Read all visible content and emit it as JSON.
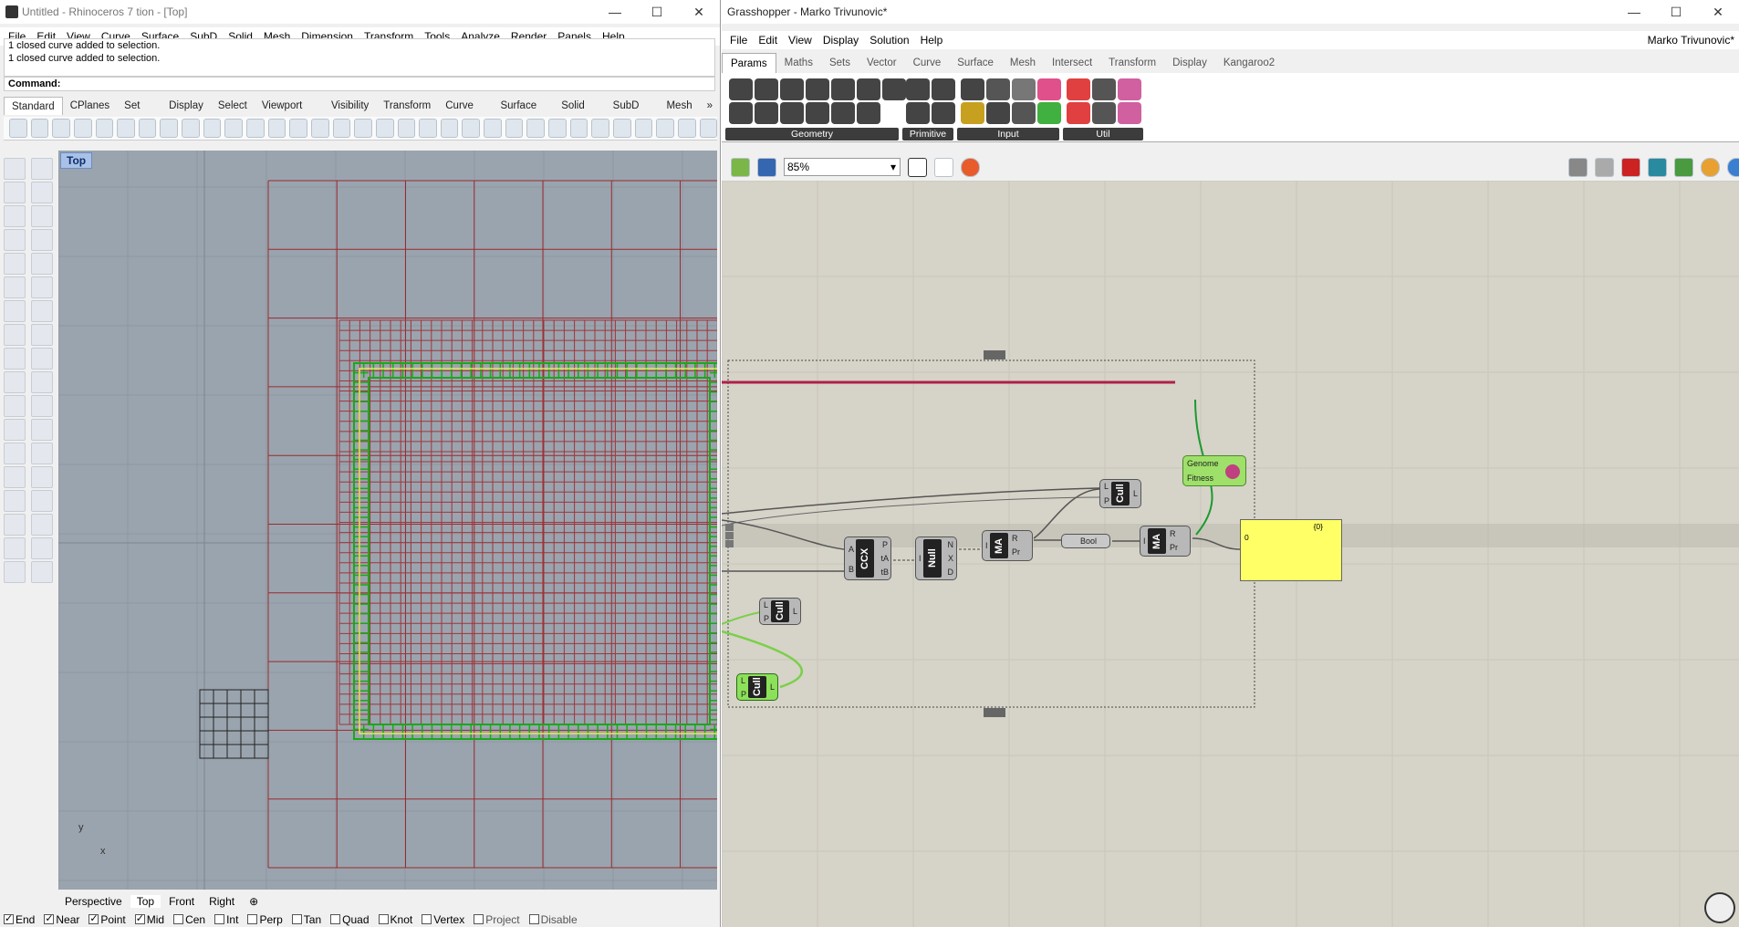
{
  "rhino": {
    "title": "Untitled - Rhinoceros 7 tion - [Top]",
    "menu": [
      "File",
      "Edit",
      "View",
      "Curve",
      "Surface",
      "SubD",
      "Solid",
      "Mesh",
      "Dimension",
      "Transform",
      "Tools",
      "Analyze",
      "Render",
      "Panels",
      "Help"
    ],
    "history": [
      "1 closed curve added to selection.",
      "1 closed curve added to selection."
    ],
    "command_label": "Command:",
    "tabs": [
      "Standard",
      "CPlanes",
      "Set View",
      "Display",
      "Select",
      "Viewport Layout",
      "Visibility",
      "Transform",
      "Curve Tools",
      "Surface Tools",
      "Solid Tools",
      "SubD Tools",
      "Mesh",
      "»"
    ],
    "viewport_label": "Top",
    "axis_y": "y",
    "axis_x": "x",
    "view_tabs": [
      "Perspective",
      "Top",
      "Front",
      "Right"
    ],
    "osnaps": [
      {
        "label": "End",
        "on": true
      },
      {
        "label": "Near",
        "on": true
      },
      {
        "label": "Point",
        "on": true
      },
      {
        "label": "Mid",
        "on": true
      },
      {
        "label": "Cen",
        "on": false
      },
      {
        "label": "Int",
        "on": false
      },
      {
        "label": "Perp",
        "on": false
      },
      {
        "label": "Tan",
        "on": false
      },
      {
        "label": "Quad",
        "on": false
      },
      {
        "label": "Knot",
        "on": false
      },
      {
        "label": "Vertex",
        "on": false
      },
      {
        "label": "Project",
        "on": false
      },
      {
        "label": "Disable",
        "on": false
      }
    ]
  },
  "grasshopper": {
    "title": "Grasshopper - Marko Trivunovic*",
    "user": "Marko Trivunovic*",
    "menu": [
      "File",
      "Edit",
      "View",
      "Display",
      "Solution",
      "Help"
    ],
    "tabs": [
      "Params",
      "Maths",
      "Sets",
      "Vector",
      "Curve",
      "Surface",
      "Mesh",
      "Intersect",
      "Transform",
      "Display",
      "Kangaroo2"
    ],
    "ribbon_groups": [
      "Geometry",
      "Primitive",
      "Input",
      "Util"
    ],
    "zoom": "85%",
    "galapagos": {
      "genome": "Genome",
      "fitness": "Fitness"
    },
    "components": {
      "cull_top": {
        "name": "Cull",
        "in": [
          "L",
          "P"
        ],
        "out": "L"
      },
      "ccx": {
        "name": "CCX",
        "in": [
          "A",
          "B"
        ],
        "out": [
          "P",
          "tA",
          "tB"
        ]
      },
      "null": {
        "name": "Null",
        "out": [
          "N",
          "X",
          "D"
        ],
        "in": "I"
      },
      "ma1": {
        "name": "MA",
        "in": "I",
        "out": [
          "R",
          "Pr"
        ]
      },
      "bool": "Bool",
      "ma2": {
        "name": "MA",
        "in": "I",
        "out": [
          "R",
          "Pr"
        ]
      },
      "cull_mid": {
        "name": "Cull",
        "in": [
          "L",
          "P"
        ],
        "out": "L"
      },
      "cull_low": {
        "name": "Cull",
        "in": [
          "L",
          "P"
        ],
        "out": "L"
      }
    },
    "panel_header": "{0}",
    "panel_index": "0"
  }
}
